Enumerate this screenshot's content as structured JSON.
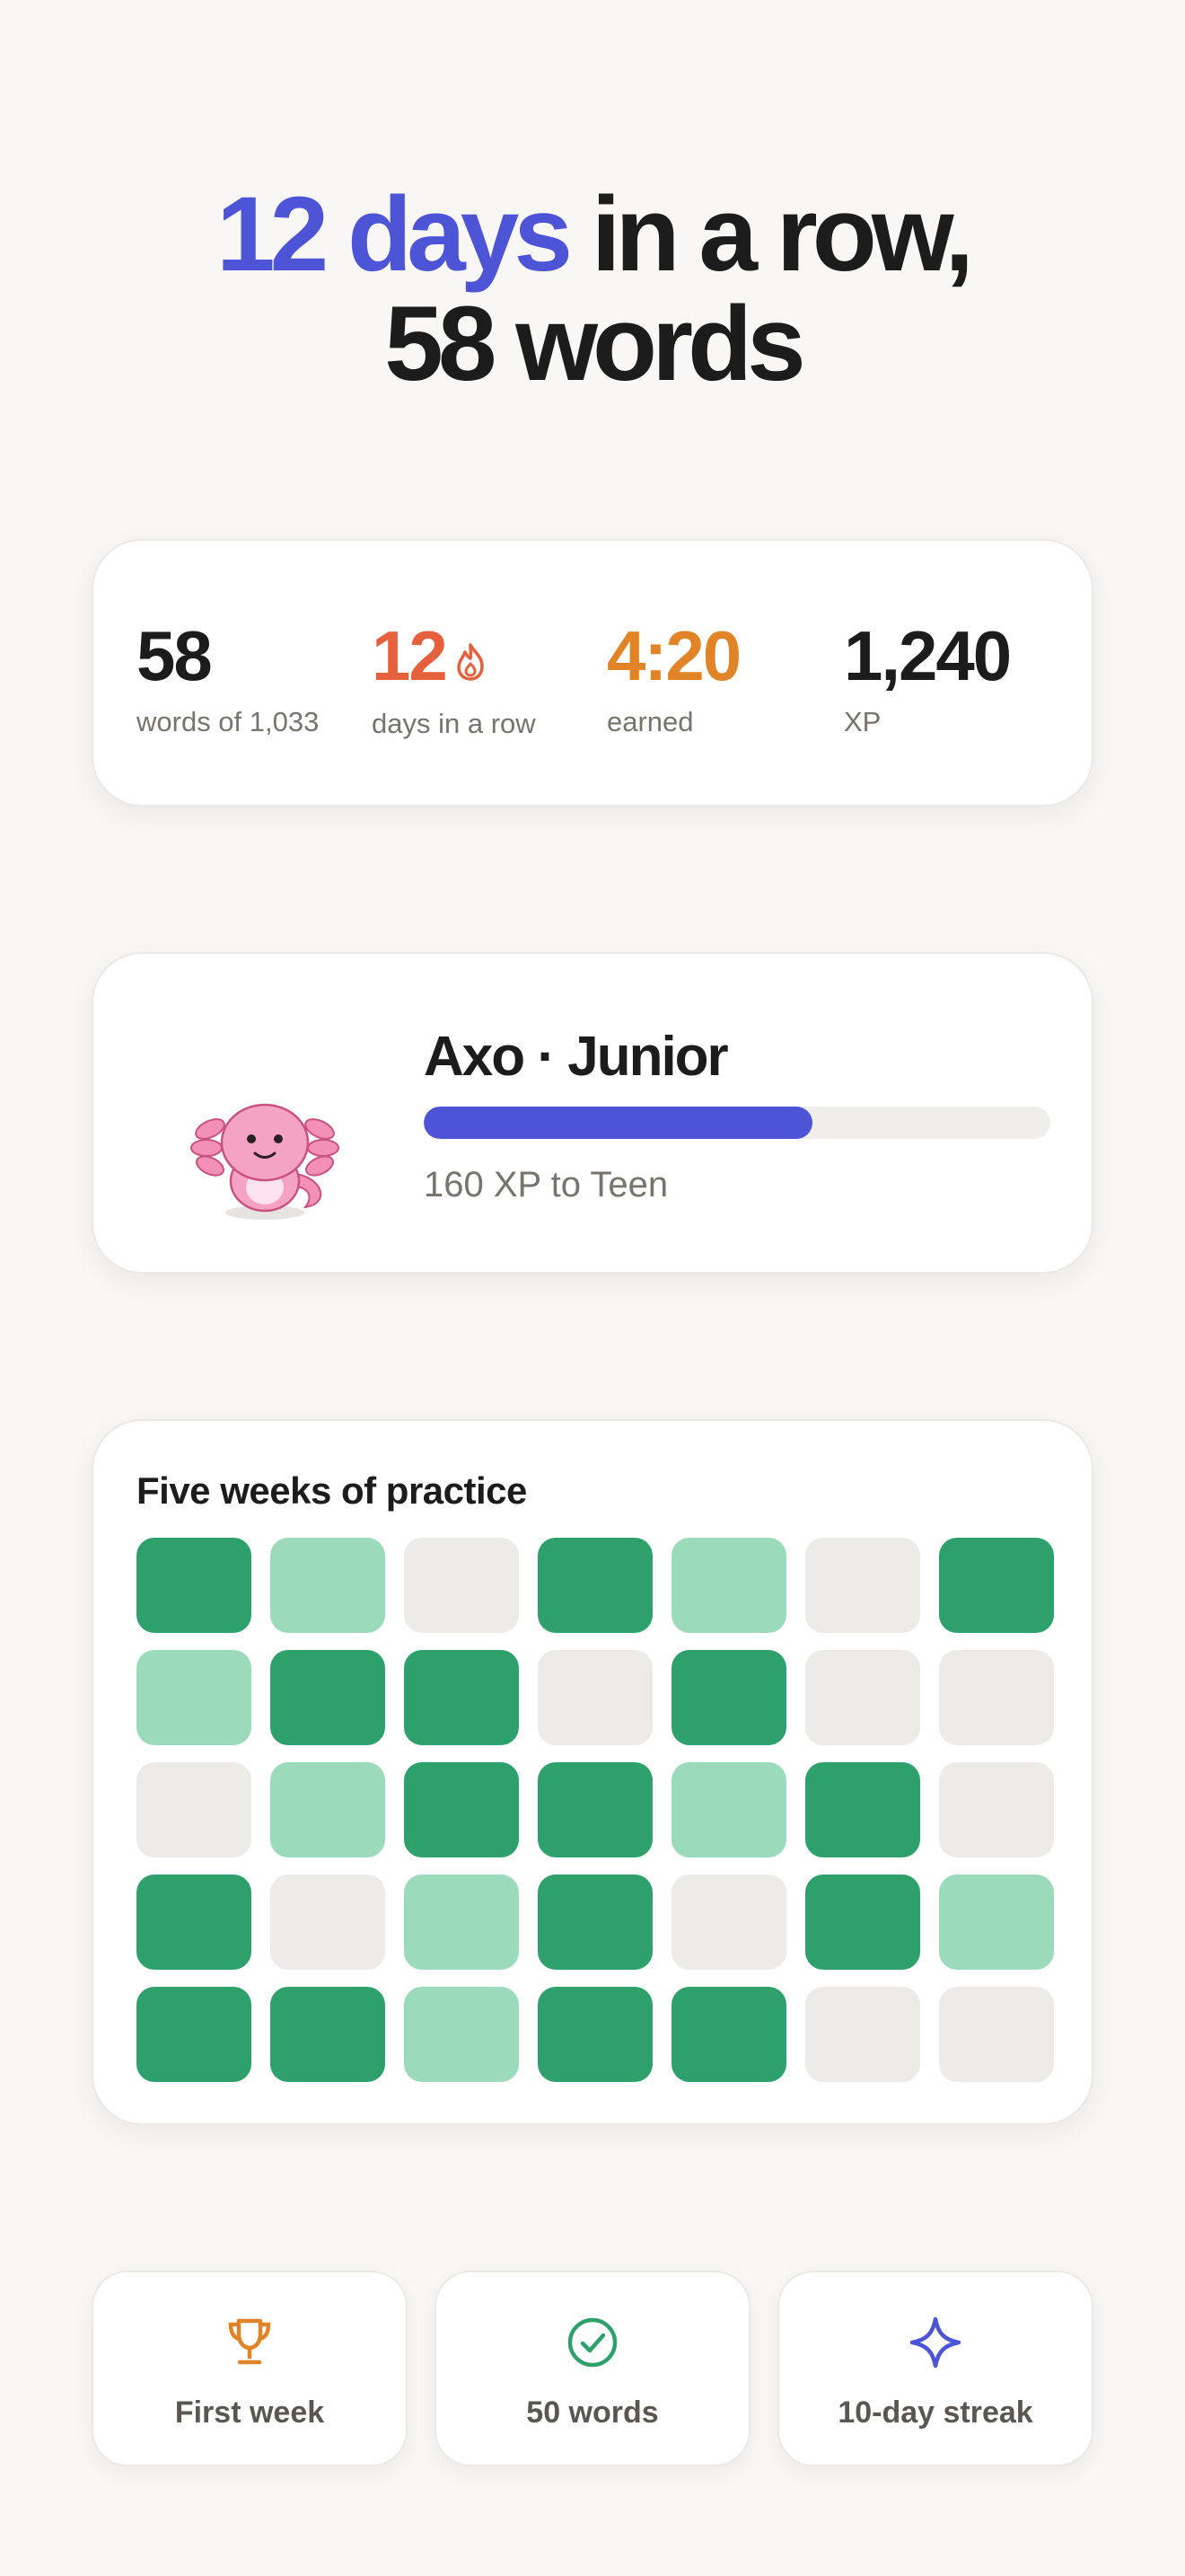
{
  "headline": {
    "accent": "12 days",
    "rest": " in a row,",
    "line2": "58 words",
    "accent_color": "#4d55d6"
  },
  "stats": [
    {
      "value": "58",
      "label": "words of 1,033"
    },
    {
      "value": "12",
      "label": "days in a row",
      "icon": "flame-icon"
    },
    {
      "value": "4:20",
      "label": "earned"
    },
    {
      "value": "1,240",
      "label": "XP"
    }
  ],
  "level": {
    "title": "Axo · Junior",
    "progress": 0.62,
    "subtitle": "160 XP to Teen",
    "mascot": "axolotl-mascot"
  },
  "practice": {
    "title": "Five weeks of practice",
    "levels_legend": {
      "0": "#ecebe7",
      "1": "#9cdabc",
      "2": "#2ea06c"
    },
    "weeks": [
      [
        2,
        1,
        0,
        2,
        1,
        0,
        2
      ],
      [
        1,
        2,
        2,
        0,
        2,
        0,
        0
      ],
      [
        0,
        1,
        2,
        2,
        1,
        2,
        0
      ],
      [
        2,
        0,
        1,
        2,
        0,
        2,
        1
      ],
      [
        2,
        2,
        1,
        2,
        2,
        0,
        0
      ]
    ]
  },
  "badges": [
    {
      "label": "First week",
      "icon": "trophy-icon",
      "color": "#e08427"
    },
    {
      "label": "50 words",
      "icon": "check-circle-icon",
      "color": "#2ea06c"
    },
    {
      "label": "10-day streak",
      "icon": "sparkle-icon",
      "color": "#4d55d6"
    }
  ]
}
